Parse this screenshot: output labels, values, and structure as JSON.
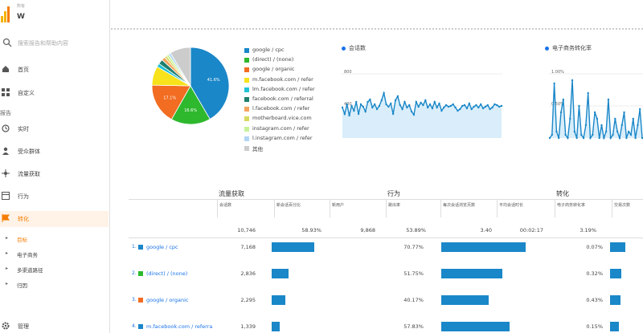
{
  "header": {
    "account": "所有",
    "property": "W"
  },
  "search": {
    "placeholder": "搜索报告和帮助内容"
  },
  "nav": {
    "home": "首页",
    "custom": "自定义",
    "reports_label": "报告",
    "realtime": "实时",
    "audience": "受众群体",
    "acquisition": "流量获取",
    "behavior": "行为",
    "conversions": "转化",
    "sub": [
      "目标",
      "电子商务",
      "多渠道路径",
      "归因"
    ],
    "admin": "管理"
  },
  "pie": {
    "legend": [
      {
        "label": "google / cpc",
        "color": "#1a87c8"
      },
      {
        "label": "(direct) / (none)",
        "color": "#2eb82e"
      },
      {
        "label": "google / organic",
        "color": "#f26c21"
      },
      {
        "label": "m.facebook.com / refer",
        "color": "#f7e21b"
      },
      {
        "label": "lm.facebook.com / refer",
        "color": "#22c3d6"
      },
      {
        "label": "facebook.com / referral",
        "color": "#1f7f6e"
      },
      {
        "label": "l.facebook.com / refer",
        "color": "#f4a460"
      },
      {
        "label": "motherboard.vice.com",
        "color": "#d9d960"
      },
      {
        "label": "instagram.com / refer",
        "color": "#c8f29a"
      },
      {
        "label": "l.instagram.com / refer",
        "color": "#b0d6f5"
      },
      {
        "label": "其他",
        "color": "#cccccc"
      }
    ],
    "slice_labels": [
      "41.6%",
      "16.6%",
      "17.1%"
    ]
  },
  "chart_data": [
    {
      "type": "pie",
      "categories": [
        "google / cpc",
        "(direct) / (none)",
        "google / organic",
        "m.facebook.com / refer",
        "lm.facebook.com / refer",
        "facebook.com / referral",
        "l.facebook.com / refer",
        "motherboard.vice.com",
        "instagram.com / refer",
        "l.instagram.com / refer",
        "其他"
      ],
      "values": [
        41.6,
        16.6,
        17.1,
        8.0,
        1.5,
        2.0,
        1.5,
        1.0,
        1.0,
        1.0,
        8.7
      ],
      "colors": [
        "#1a87c8",
        "#2eb82e",
        "#f26c21",
        "#f7e21b",
        "#22c3d6",
        "#1f7f6e",
        "#f4a460",
        "#d9d960",
        "#c8f29a",
        "#b0d6f5",
        "#cccccc"
      ]
    },
    {
      "type": "area",
      "title": "会话数",
      "y_ticks": [
        "800",
        "400"
      ],
      "ylim": [
        0,
        800
      ],
      "values": [
        380,
        300,
        420,
        280,
        400,
        340,
        450,
        300,
        420,
        390,
        330,
        450,
        480,
        380,
        420,
        360,
        400,
        470,
        560,
        420,
        390,
        430,
        300,
        470,
        520,
        410,
        360,
        450,
        380,
        410,
        330,
        290,
        450,
        390,
        440,
        410,
        470,
        380,
        420,
        370,
        450,
        380,
        430,
        340,
        380,
        410,
        390,
        400,
        420,
        380,
        340,
        360,
        400,
        410,
        370,
        430,
        360,
        390,
        410,
        380,
        420,
        370,
        390,
        410,
        360,
        380,
        420,
        410,
        390,
        400
      ]
    },
    {
      "type": "area",
      "title": "电子商务转化率",
      "y_ticks": [
        "1.00%",
        "0.50%"
      ],
      "ylim": [
        0,
        1.0
      ],
      "values": [
        0,
        0.05,
        0.85,
        0.1,
        0,
        0.4,
        0.6,
        0.05,
        0,
        0.3,
        0.9,
        0.1,
        0,
        0.5,
        0.05,
        0,
        0.2,
        0.7,
        0,
        0.05,
        0.4,
        0.3,
        0,
        0.2,
        0,
        0.1,
        0.6,
        0,
        0.05,
        0.3,
        0.1,
        0,
        0.2,
        0.4,
        0,
        0.1,
        0.05,
        0.3,
        0,
        0.2,
        0.45,
        0
      ]
    }
  ],
  "table": {
    "group_headers": [
      "流量获取",
      "行为",
      "转化"
    ],
    "columns": [
      "会话数",
      "新会话百分比",
      "新用户",
      "跳出率",
      "每次会话浏览页数",
      "平均会话时长",
      "电子商务转化率",
      "交易次数"
    ],
    "totals": [
      "10,746",
      "58.93%",
      "9,868",
      "53.89%",
      "3.40",
      "00:02:17",
      "3.19%",
      ""
    ],
    "rows": [
      {
        "num": "1.",
        "label": "google / cpc",
        "color": "#1a87c8",
        "sessions": "7,168",
        "sess_frac": 0.74,
        "bounce": "70.77%",
        "bounce_frac": 0.94,
        "conv": "0.07%",
        "conv_frac": 0.52
      },
      {
        "num": "2.",
        "label": "(direct) / (none)",
        "color": "#2eb82e",
        "sessions": "2,836",
        "sess_frac": 0.29,
        "bounce": "51.75%",
        "bounce_frac": 0.68,
        "conv": "0.32%",
        "conv_frac": 0.38
      },
      {
        "num": "3.",
        "label": "google / organic",
        "color": "#f26c21",
        "sessions": "2,295",
        "sess_frac": 0.24,
        "bounce": "40.17%",
        "bounce_frac": 0.53,
        "conv": "0.43%",
        "conv_frac": 0.35
      },
      {
        "num": "4.",
        "label": "m.facebook.com / referra",
        "color": "#1a87c8",
        "sessions": "1,339",
        "sess_frac": 0.14,
        "bounce": "57.83%",
        "bounce_frac": 0.76,
        "conv": "0.15%",
        "conv_frac": 0.3
      }
    ]
  }
}
